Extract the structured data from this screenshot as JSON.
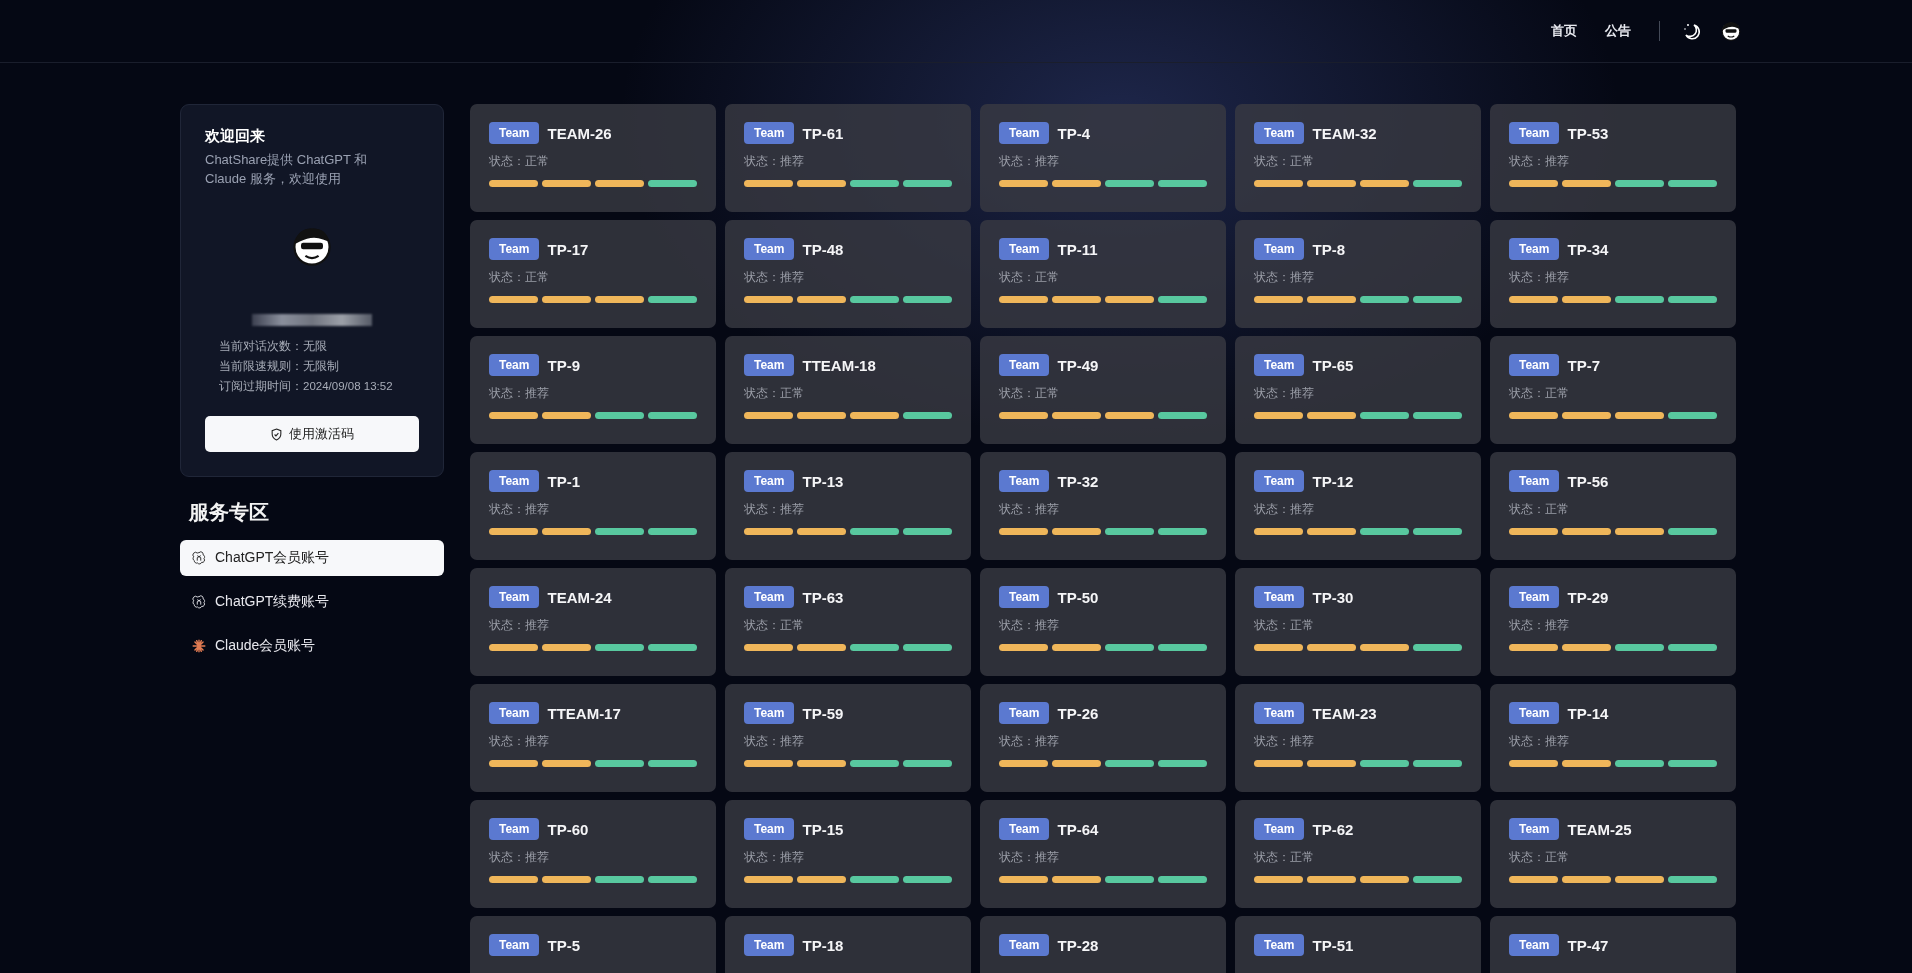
{
  "header": {
    "nav": [
      {
        "label": "首页"
      },
      {
        "label": "公告"
      }
    ]
  },
  "profile": {
    "title": "欢迎回来",
    "description": "ChatShare提供 ChatGPT 和 Claude 服务，欢迎使用",
    "stats": [
      "当前对话次数：无限",
      "当前限速规则：无限制",
      "订阅过期时间：2024/09/08 13:52"
    ],
    "button": "使用激活码"
  },
  "services": {
    "heading": "服务专区",
    "items": [
      {
        "label": "ChatGPT会员账号",
        "kind": "chatgpt",
        "selected": true
      },
      {
        "label": "ChatGPT续费账号",
        "kind": "chatgpt",
        "selected": false
      },
      {
        "label": "Claude会员账号",
        "kind": "claude",
        "selected": false
      }
    ]
  },
  "cards": [
    {
      "badge": "Team",
      "name": "TEAM-26",
      "status": "状态：正常",
      "level": 0.75
    },
    {
      "badge": "Team",
      "name": "TP-61",
      "status": "状态：推荐",
      "level": 0.5
    },
    {
      "badge": "Team",
      "name": "TP-4",
      "status": "状态：推荐",
      "level": 0.5
    },
    {
      "badge": "Team",
      "name": "TEAM-32",
      "status": "状态：正常",
      "level": 0.75
    },
    {
      "badge": "Team",
      "name": "TP-53",
      "status": "状态：推荐",
      "level": 0.5
    },
    {
      "badge": "Team",
      "name": "TP-17",
      "status": "状态：正常",
      "level": 0.75
    },
    {
      "badge": "Team",
      "name": "TP-48",
      "status": "状态：推荐",
      "level": 0.5
    },
    {
      "badge": "Team",
      "name": "TP-11",
      "status": "状态：正常",
      "level": 0.75
    },
    {
      "badge": "Team",
      "name": "TP-8",
      "status": "状态：推荐",
      "level": 0.5
    },
    {
      "badge": "Team",
      "name": "TP-34",
      "status": "状态：推荐",
      "level": 0.5
    },
    {
      "badge": "Team",
      "name": "TP-9",
      "status": "状态：推荐",
      "level": 0.5
    },
    {
      "badge": "Team",
      "name": "TTEAM-18",
      "status": "状态：正常",
      "level": 0.75
    },
    {
      "badge": "Team",
      "name": "TP-49",
      "status": "状态：正常",
      "level": 0.75
    },
    {
      "badge": "Team",
      "name": "TP-65",
      "status": "状态：推荐",
      "level": 0.5
    },
    {
      "badge": "Team",
      "name": "TP-7",
      "status": "状态：正常",
      "level": 0.75
    },
    {
      "badge": "Team",
      "name": "TP-1",
      "status": "状态：推荐",
      "level": 0.5
    },
    {
      "badge": "Team",
      "name": "TP-13",
      "status": "状态：推荐",
      "level": 0.5
    },
    {
      "badge": "Team",
      "name": "TP-32",
      "status": "状态：推荐",
      "level": 0.5
    },
    {
      "badge": "Team",
      "name": "TP-12",
      "status": "状态：推荐",
      "level": 0.5
    },
    {
      "badge": "Team",
      "name": "TP-56",
      "status": "状态：正常",
      "level": 0.75
    },
    {
      "badge": "Team",
      "name": "TEAM-24",
      "status": "状态：推荐",
      "level": 0.5
    },
    {
      "badge": "Team",
      "name": "TP-63",
      "status": "状态：正常",
      "level": 0.5
    },
    {
      "badge": "Team",
      "name": "TP-50",
      "status": "状态：推荐",
      "level": 0.5
    },
    {
      "badge": "Team",
      "name": "TP-30",
      "status": "状态：正常",
      "level": 0.75
    },
    {
      "badge": "Team",
      "name": "TP-29",
      "status": "状态：推荐",
      "level": 0.5
    },
    {
      "badge": "Team",
      "name": "TTEAM-17",
      "status": "状态：推荐",
      "level": 0.5
    },
    {
      "badge": "Team",
      "name": "TP-59",
      "status": "状态：推荐",
      "level": 0.5
    },
    {
      "badge": "Team",
      "name": "TP-26",
      "status": "状态：推荐",
      "level": 0.5
    },
    {
      "badge": "Team",
      "name": "TEAM-23",
      "status": "状态：推荐",
      "level": 0.5
    },
    {
      "badge": "Team",
      "name": "TP-14",
      "status": "状态：推荐",
      "level": 0.5
    },
    {
      "badge": "Team",
      "name": "TP-60",
      "status": "状态：推荐",
      "level": 0.5
    },
    {
      "badge": "Team",
      "name": "TP-15",
      "status": "状态：推荐",
      "level": 0.5
    },
    {
      "badge": "Team",
      "name": "TP-64",
      "status": "状态：推荐",
      "level": 0.5
    },
    {
      "badge": "Team",
      "name": "TP-62",
      "status": "状态：正常",
      "level": 0.75
    },
    {
      "badge": "Team",
      "name": "TEAM-25",
      "status": "状态：正常",
      "level": 0.75
    },
    {
      "badge": "Team",
      "name": "TP-5"
    },
    {
      "badge": "Team",
      "name": "TP-18"
    },
    {
      "badge": "Team",
      "name": "TP-28"
    },
    {
      "badge": "Team",
      "name": "TP-51"
    },
    {
      "badge": "Team",
      "name": "TP-47"
    }
  ]
}
